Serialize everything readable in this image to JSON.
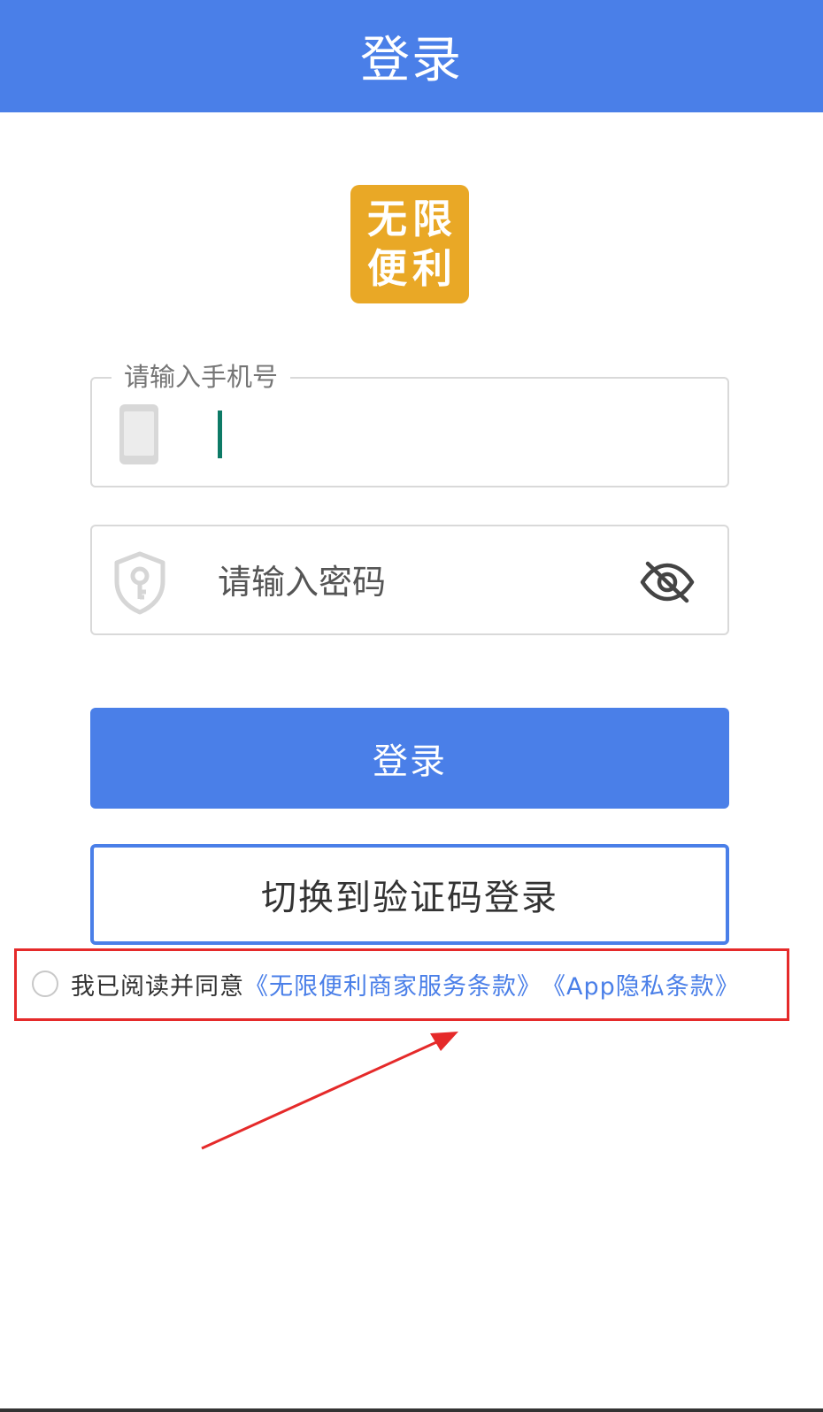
{
  "header": {
    "title": "登录"
  },
  "logo": {
    "line1": "无限",
    "line2": "便利"
  },
  "phone_field": {
    "label": "请输入手机号",
    "value": "",
    "icon": "phone-icon"
  },
  "password_field": {
    "placeholder": "请输入密码",
    "value": "",
    "icon": "shield-key-icon",
    "toggle_icon": "eye-off-icon"
  },
  "buttons": {
    "login_label": "登录",
    "switch_label": "切换到验证码登录"
  },
  "agreement": {
    "text": "我已阅读并同意",
    "terms_link": "《无限便利商家服务条款》",
    "privacy_link": "《App隐私条款》",
    "checked": false
  },
  "colors": {
    "primary": "#4a7fe8",
    "logo_bg": "#e9a826",
    "highlight_box": "#e52a2a",
    "cursor": "#0d7a66"
  }
}
